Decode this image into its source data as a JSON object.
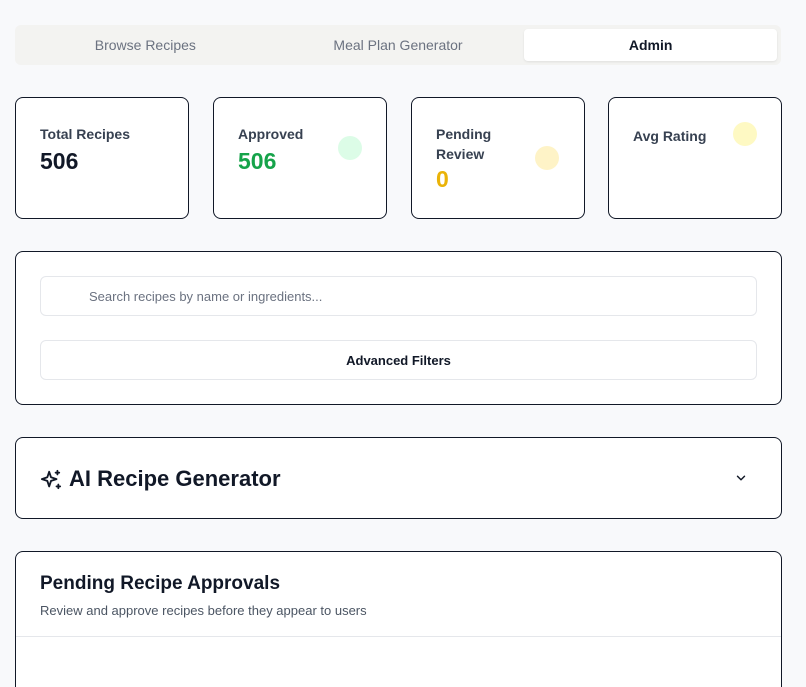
{
  "tabs": [
    {
      "label": "Browse Recipes"
    },
    {
      "label": "Meal Plan Generator"
    },
    {
      "label": "Admin"
    }
  ],
  "stats": {
    "total": {
      "label": "Total Recipes",
      "value": "506"
    },
    "approved": {
      "label": "Approved",
      "value": "506",
      "color": "#16a34a",
      "dot_color": "#dcfce7"
    },
    "pending": {
      "label": "Pending Review",
      "value": "0",
      "color": "#eab308",
      "dot_color": "#fef3c7"
    },
    "rating": {
      "label": "Avg Rating",
      "value": "",
      "dot_color": "#fef9c3"
    }
  },
  "search": {
    "placeholder": "Search recipes by name or ingredients...",
    "filters_label": "Advanced Filters"
  },
  "ai_generator": {
    "title": "AI Recipe Generator",
    "icon": "sparkles-icon"
  },
  "pending_approvals": {
    "title": "Pending Recipe Approvals",
    "subtitle": "Review and approve recipes before they appear to users"
  }
}
